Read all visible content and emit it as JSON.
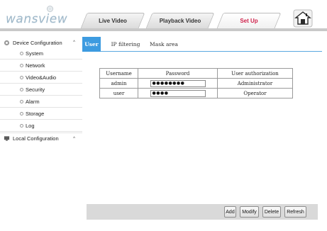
{
  "header": {
    "logo_text": "wansview",
    "tabs": [
      {
        "label": "Live Video"
      },
      {
        "label": "Playback Video"
      },
      {
        "label": "Set Up"
      }
    ],
    "active_color": "#d0244d"
  },
  "sidebar": {
    "device_group": "Device Configuration",
    "device_items": [
      {
        "label": "System"
      },
      {
        "label": "Network"
      },
      {
        "label": "Video&Audio"
      },
      {
        "label": "Security"
      },
      {
        "label": "Alarm"
      },
      {
        "label": "Storage"
      },
      {
        "label": "Log"
      }
    ],
    "local_group": "Local Configuration",
    "caret": "^"
  },
  "subtabs": [
    {
      "label": "User"
    },
    {
      "label": "IP filtering"
    },
    {
      "label": "Mask area"
    }
  ],
  "accent_color": "#3d9be0",
  "user_table": {
    "headers": [
      "Username",
      "Password",
      "User authorization"
    ],
    "rows": [
      {
        "username": "admin",
        "password": "●●●●●●●●",
        "authorization": "Administrator"
      },
      {
        "username": "user",
        "password": "●●●●",
        "authorization": "Operator"
      }
    ]
  },
  "actions": {
    "add": "Add",
    "modify": "Modify",
    "delete": "Delete",
    "refresh": "Refresh"
  }
}
